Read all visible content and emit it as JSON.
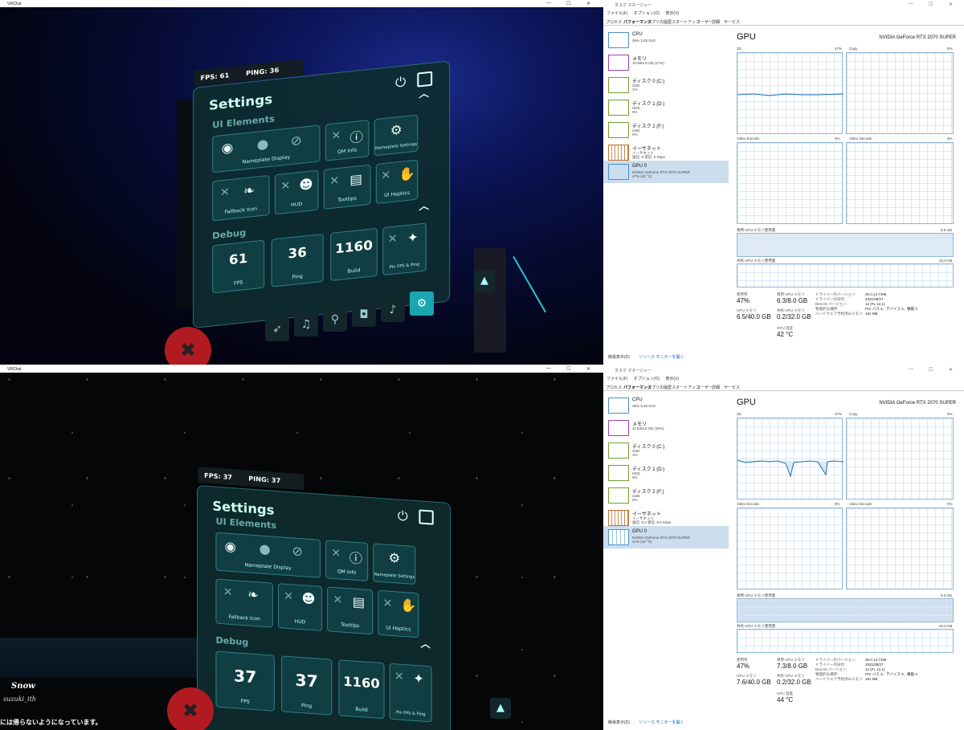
{
  "captures": [
    {
      "vr": {
        "window_title": "VRChat",
        "fps_label": "FPS: 61",
        "ping_label": "PING: 36",
        "panel_title": "Settings",
        "ui_section": "UI Elements",
        "debug_section": "Debug",
        "tiles": {
          "nameplate": "Nameplate Display",
          "qm_info": "QM Info",
          "nameplate_settings": "Nameplate Settings",
          "fallback_icon": "Fallback Icon",
          "hud": "HUD",
          "tooltips": "Tooltips",
          "ui_haptics": "UI Haptics",
          "fps_value": "61",
          "fps_label": "FPS",
          "ping_value": "36",
          "ping_label": "Ping",
          "build_value": "1160",
          "build_label": "Build",
          "pin": "Pin FPS & Ping"
        },
        "world_text": ""
      },
      "tm": {
        "window_title": "タスク マネージャー",
        "menu": [
          "ファイル(F)",
          "オプション(O)",
          "表示(V)"
        ],
        "tabs": [
          "プロセス",
          "パフォーマンス",
          "アプリの履歴",
          "スタートアップ",
          "ユーザー",
          "詳細",
          "サービス"
        ],
        "sidebar": [
          {
            "name": "CPU",
            "sub": "29% 3.49 GHz"
          },
          {
            "name": "メモリ",
            "sub": "10.9/63.9 GB (17%)"
          },
          {
            "name": "ディスク 0 (C:)",
            "sub": "SSD\n1%"
          },
          {
            "name": "ディスク 1 (D:)",
            "sub": "HDD\n0%"
          },
          {
            "name": "ディスク 2 (F:)",
            "sub": "USB\n0%"
          },
          {
            "name": "イーサネット",
            "sub": "イーサネット\n送信: 8 受信: 0 Kbps"
          },
          {
            "name": "GPU 0",
            "sub": "NVIDIA GeForce RTX 2070 SUPER\n47% (42 °C)"
          }
        ],
        "gpu_title": "GPU",
        "gpu_name": "NVIDIA GeForce RTX 2070 SUPER",
        "graph_labels": {
          "g3d": "3D",
          "g3d_pct": "47%",
          "copy": "Copy",
          "copy_pct": "0%",
          "venc": "Video Encode",
          "venc_pct": "0%",
          "vdec": "Video Decode",
          "vdec_pct": "0%",
          "dedicated": "専用 GPU メモリ使用量",
          "dedicated_max": "8.0 GB",
          "shared": "共有 GPU メモリ使用量",
          "shared_max": "32.0 GB"
        },
        "stats": {
          "util_label": "使用率",
          "util": "47%",
          "ded_label": "専用 GPU メモリ",
          "ded": "6.3/8.0 GB",
          "gpumem_label": "GPU メモリ",
          "gpumem": "6.5/40.0 GB",
          "shared_label": "共有 GPU メモリ",
          "shared": "0.2/32.0 GB",
          "temp_label": "GPU 温度",
          "temp": "42 °C",
          "driver_ver_label": "ドライバーのバージョン:",
          "driver_ver": "30.0.14.7196",
          "driver_date_label": "ドライバーの日付:",
          "driver_date": "2021/08/27",
          "dx_label": "DirectX バージョン:",
          "dx": "12 (FL 12.1)",
          "loc_label": "物理的な場所:",
          "loc": "PCI バス 3、デバイス 0、機能 0",
          "hw_label": "ハードウェア予約済みメモリ:",
          "hw": "181 MB"
        },
        "footer_less": "簡易表示(D)",
        "footer_link": "リソース モニターを開く"
      }
    },
    {
      "vr": {
        "window_title": "VRChat",
        "fps_label": "FPS: 37",
        "ping_label": "PING: 37",
        "panel_title": "Settings",
        "ui_section": "UI Elements",
        "debug_section": "Debug",
        "tiles": {
          "nameplate": "Nameplate Display",
          "qm_info": "QM Info",
          "nameplate_settings": "Nameplate Settings",
          "fallback_icon": "Fallback Icon",
          "hud": "HUD",
          "tooltips": "Tooltips",
          "ui_haptics": "UI Haptics",
          "fps_value": "37",
          "fps_label": "FPS",
          "ping_value": "37",
          "ping_label": "Ping",
          "build_value": "1160",
          "build_label": "Build",
          "pin": "Pin FPS & Ping"
        },
        "world_text": "Snow",
        "world_text2": "suzuki_ith",
        "world_text3": "には帰らないようになっています。"
      },
      "tm": {
        "window_title": "タスク マネージャー",
        "menu": [
          "ファイル(F)",
          "オプション(O)",
          "表示(V)"
        ],
        "tabs": [
          "プロセス",
          "パフォーマンス",
          "アプリの履歴",
          "スタートアップ",
          "ユーザー",
          "詳細",
          "サービス"
        ],
        "sidebar": [
          {
            "name": "CPU",
            "sub": "35% 3.48 GHz"
          },
          {
            "name": "メモリ",
            "sub": "11.5/63.9 GB (18%)"
          },
          {
            "name": "ディスク 0 (C:)",
            "sub": "SSD\n1%"
          },
          {
            "name": "ディスク 1 (D:)",
            "sub": "HDD\n0%"
          },
          {
            "name": "ディスク 2 (F:)",
            "sub": "USB\n0%"
          },
          {
            "name": "イーサネット",
            "sub": "イーサネット\n送信: 8.0 受信: 8.0 Kbps"
          },
          {
            "name": "GPU 0",
            "sub": "NVIDIA GeForce RTX 2070 SUPER\n47% (44 °C)"
          }
        ],
        "gpu_title": "GPU",
        "gpu_name": "NVIDIA GeForce RTX 2070 SUPER",
        "graph_labels": {
          "g3d": "3D",
          "g3d_pct": "47%",
          "copy": "Copy",
          "copy_pct": "0%",
          "venc": "Video Encode",
          "venc_pct": "0%",
          "vdec": "Video Decode",
          "vdec_pct": "0%",
          "dedicated": "専用 GPU メモリ使用量",
          "dedicated_max": "8.0 GB",
          "shared": "共有 GPU メモリ使用量",
          "shared_max": "32.0 GB"
        },
        "stats": {
          "util_label": "使用率",
          "util": "47%",
          "ded_label": "専用 GPU メモリ",
          "ded": "7.3/8.0 GB",
          "gpumem_label": "GPU メモリ",
          "gpumem": "7.6/40.0 GB",
          "shared_label": "共有 GPU メモリ",
          "shared": "0.2/32.0 GB",
          "temp_label": "GPU 温度",
          "temp": "44 °C",
          "driver_ver_label": "ドライバーのバージョン:",
          "driver_ver": "30.0.14.7196",
          "driver_date_label": "ドライバーの日付:",
          "driver_date": "2021/08/27",
          "dx_label": "DirectX バージョン:",
          "dx": "12 (FL 12.1)",
          "loc_label": "物理的な場所:",
          "loc": "PCI バス 3、デバイス 0、機能 0",
          "hw_label": "ハードウェア予約済みメモリ:",
          "hw": "181 MB"
        },
        "footer_less": "簡易表示(D)",
        "footer_link": "リソース モニターを開く"
      }
    }
  ]
}
